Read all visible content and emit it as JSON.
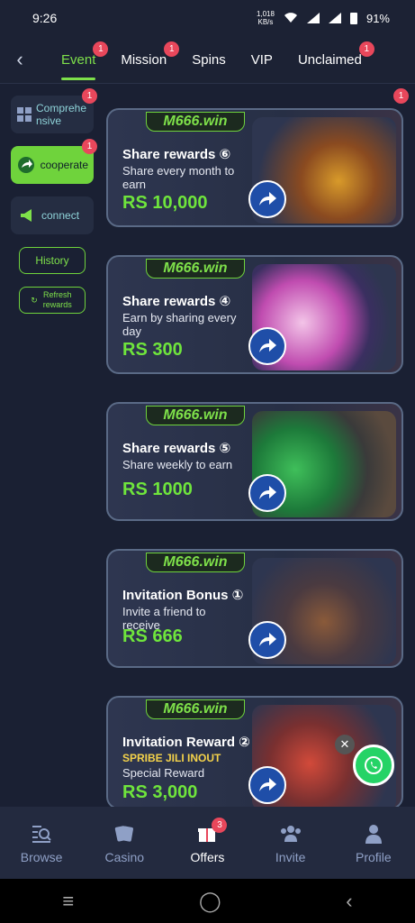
{
  "status": {
    "time": "9:26",
    "netspeed_top": "1,018",
    "netspeed_bottom": "KB/s",
    "battery": "91%"
  },
  "tabs": [
    {
      "label": "Event",
      "badge": "1"
    },
    {
      "label": "Mission",
      "badge": "1"
    },
    {
      "label": "Spins"
    },
    {
      "label": "VIP"
    },
    {
      "label": "Unclaimed",
      "badge": "1"
    }
  ],
  "sidebar": {
    "items": [
      {
        "label": "Comprehensive",
        "badge": "1"
      },
      {
        "label": "cooperate",
        "badge": "1"
      },
      {
        "label": "connect"
      }
    ],
    "history_label": "History",
    "refresh_label": "Refresh rewards"
  },
  "cards_badge": "1",
  "cards": [
    {
      "logo": "M666.win",
      "title": "Share rewards ⑥",
      "desc": "Share every month to earn",
      "amount": "RS 10,000"
    },
    {
      "logo": "M666.win",
      "title": "Share rewards ④",
      "desc": "Earn by sharing every day",
      "amount": "RS 300"
    },
    {
      "logo": "M666.win",
      "title": "Share rewards ⑤",
      "desc": "Share weekly to earn",
      "amount": "RS 1000"
    },
    {
      "logo": "M666.win",
      "title": "Invitation Bonus ①",
      "desc": "Invite a friend to receive",
      "amount": "RS 666"
    },
    {
      "logo": "M666.win",
      "title": "Invitation Reward ②",
      "providers": "SPRIBE JILI INOUT",
      "desc": "Special Reward",
      "amount": "RS 3,000"
    }
  ],
  "bottom_nav": [
    {
      "label": "Browse",
      "icon": "browse-icon"
    },
    {
      "label": "Casino",
      "icon": "cards-icon"
    },
    {
      "label": "Offers",
      "icon": "gift-icon",
      "badge": "3"
    },
    {
      "label": "Invite",
      "icon": "people-icon"
    },
    {
      "label": "Profile",
      "icon": "person-icon"
    }
  ],
  "colors": {
    "accent": "#6fd33c",
    "background": "#1a2033",
    "badge": "#e8475b"
  }
}
